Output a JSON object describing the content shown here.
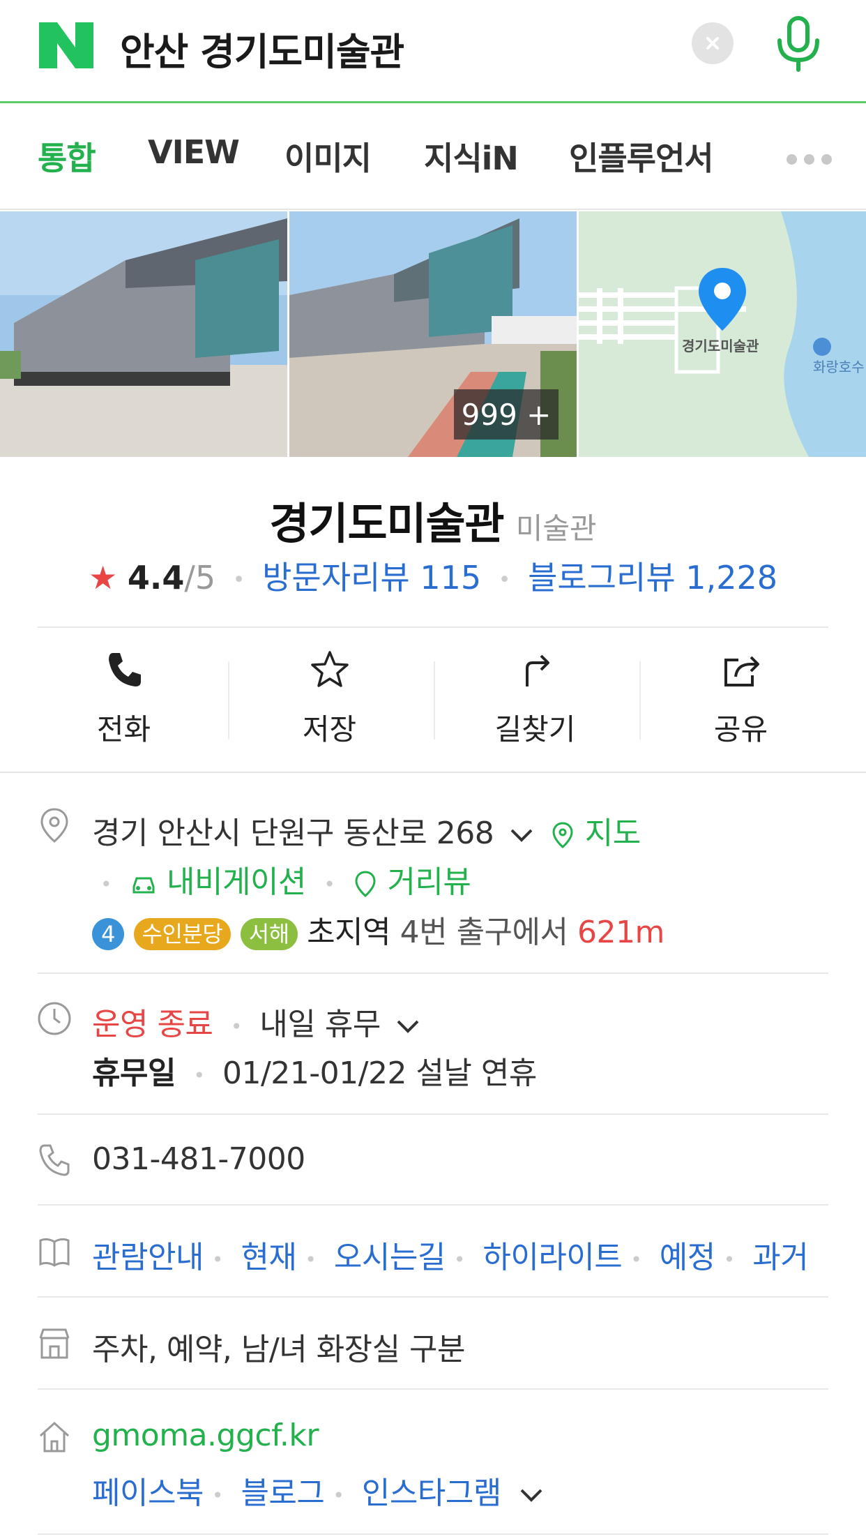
{
  "search": {
    "query": "안산 경기도미술관",
    "logo_letter": "N"
  },
  "tabs": [
    {
      "label": "통합",
      "active": true
    },
    {
      "label": "VIEW",
      "active": false
    },
    {
      "label": "이미지",
      "active": false
    },
    {
      "label": "지식iN",
      "active": false
    },
    {
      "label": "인플루언서",
      "active": false
    }
  ],
  "photos": {
    "count_label": "999 +",
    "map_label": "경기도미술관",
    "map_nearby_label": "화랑호수"
  },
  "place": {
    "name": "경기도미술관",
    "category": "미술관",
    "rating": "4.4",
    "rating_max": "/5",
    "visitor_reviews": "방문자리뷰 115",
    "blog_reviews": "블로그리뷰 1,228"
  },
  "actions": [
    {
      "label": "전화",
      "icon": "phone-icon"
    },
    {
      "label": "저장",
      "icon": "star-icon"
    },
    {
      "label": "길찾기",
      "icon": "directions-icon"
    },
    {
      "label": "공유",
      "icon": "share-icon"
    }
  ],
  "address": {
    "text": "경기 안산시 단원구 동산로 268",
    "map_link": "지도",
    "navigation_link": "내비게이션",
    "streetview_link": "거리뷰",
    "subway_line_number": "4",
    "subway_line_suin": "수인분당",
    "subway_line_seohae": "서해",
    "station": "초지역",
    "exit_text": "4번 출구에서",
    "distance": "621m"
  },
  "hours": {
    "status": "운영 종료",
    "next": "내일 휴무",
    "holiday_label": "휴무일",
    "holiday_text": "01/21-01/22 설날 연휴"
  },
  "phone": "031-481-7000",
  "menu_links": [
    "관람안내",
    "현재",
    "오시는길",
    "하이라이트",
    "예정",
    "과거"
  ],
  "facilities": "주차, 예약, 남/녀 화장실 구분",
  "homepage": {
    "url": "gmoma.ggcf.kr",
    "links": [
      "페이스북",
      "블로그",
      "인스타그램"
    ]
  },
  "colors": {
    "naver_green": "#03c75a",
    "link_blue": "#2a6dd1",
    "alert_red": "#e84545"
  }
}
